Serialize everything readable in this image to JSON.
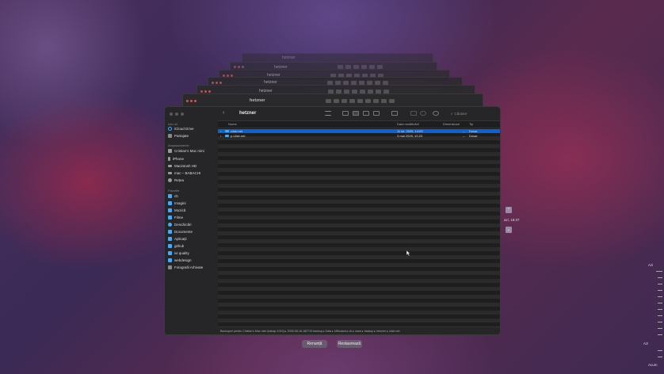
{
  "ghost_windows": [
    {
      "title": "hetzner"
    },
    {
      "title": "hetzner"
    },
    {
      "title": "hetzner"
    },
    {
      "title": "hetzner"
    },
    {
      "title": "hetzner"
    }
  ],
  "sidebar": {
    "sections": [
      {
        "label": "Iclo ud",
        "items": [
          {
            "label": "iCloud Drive",
            "icon": "cloud-icon"
          },
          {
            "label": "Partajate",
            "icon": "shared-folder-icon"
          }
        ]
      },
      {
        "label": "Amplasamente",
        "items": [
          {
            "label": "Cristian's Mac mini",
            "icon": "computer-icon"
          },
          {
            "label": "iPhone",
            "icon": "phone-icon"
          },
          {
            "label": "Macintosh HD",
            "icon": "drive-icon"
          },
          {
            "label": "mac – BABACHI",
            "icon": "network-drive-icon"
          },
          {
            "label": "Rețea",
            "icon": "network-icon"
          }
        ]
      },
      {
        "label": "Favorite",
        "items": [
          {
            "label": "cb",
            "icon": "home-icon"
          },
          {
            "label": "Imagini",
            "icon": "folder-icon"
          },
          {
            "label": "Muzică",
            "icon": "music-icon"
          },
          {
            "label": "Filme",
            "icon": "film-icon"
          },
          {
            "label": "Descărcări",
            "icon": "download-icon"
          },
          {
            "label": "Documente",
            "icon": "document-icon"
          },
          {
            "label": "Aplicații",
            "icon": "apps-icon"
          },
          {
            "label": "github",
            "icon": "folder-icon"
          },
          {
            "label": "ivr.quality",
            "icon": "folder-icon"
          },
          {
            "label": "webdesign",
            "icon": "folder-icon"
          },
          {
            "label": "Fotografii Arhivate",
            "icon": "photos-icon"
          }
        ]
      }
    ]
  },
  "toolbar": {
    "title": "hetzner",
    "search_placeholder": "Căutare",
    "back": "‹"
  },
  "columns": {
    "name": "Nume",
    "date": "Data modificării",
    "size": "Dimensiune",
    "kind": "Tip"
  },
  "files": [
    {
      "name": "c4sb.net",
      "date": "11 iul. 2025, 14:09",
      "size": "--",
      "kind": "Dosar",
      "selected": true
    },
    {
      "name": "p.c4sb.net",
      "date": "3 mai 2025, 12:23",
      "size": "--",
      "kind": "Dosar",
      "selected": false
    }
  ],
  "pathbar": "Backupuri pentru Cristian's Mac mini (babap-1010) ▸ 2025-08-16-182710.backup ▸ Data ▸ Utilizatori ▸ cb ▸ www ▸ backup ▸ hetzner ▸ c4sb.net",
  "buttons": {
    "cancel": "Renunță",
    "restore": "Restaurează"
  },
  "timeline": {
    "current_label": "azi, 18:37",
    "up": "⌃",
    "down": "⌄",
    "top_label": "Azi",
    "mid_label": "Azi",
    "bottom_label": "Acum"
  },
  "colors": {
    "selection": "#0a63d6",
    "folder": "#4aa8f0",
    "close": "#ff5f57",
    "minimize": "#febc2e",
    "zoom": "#28c840"
  }
}
